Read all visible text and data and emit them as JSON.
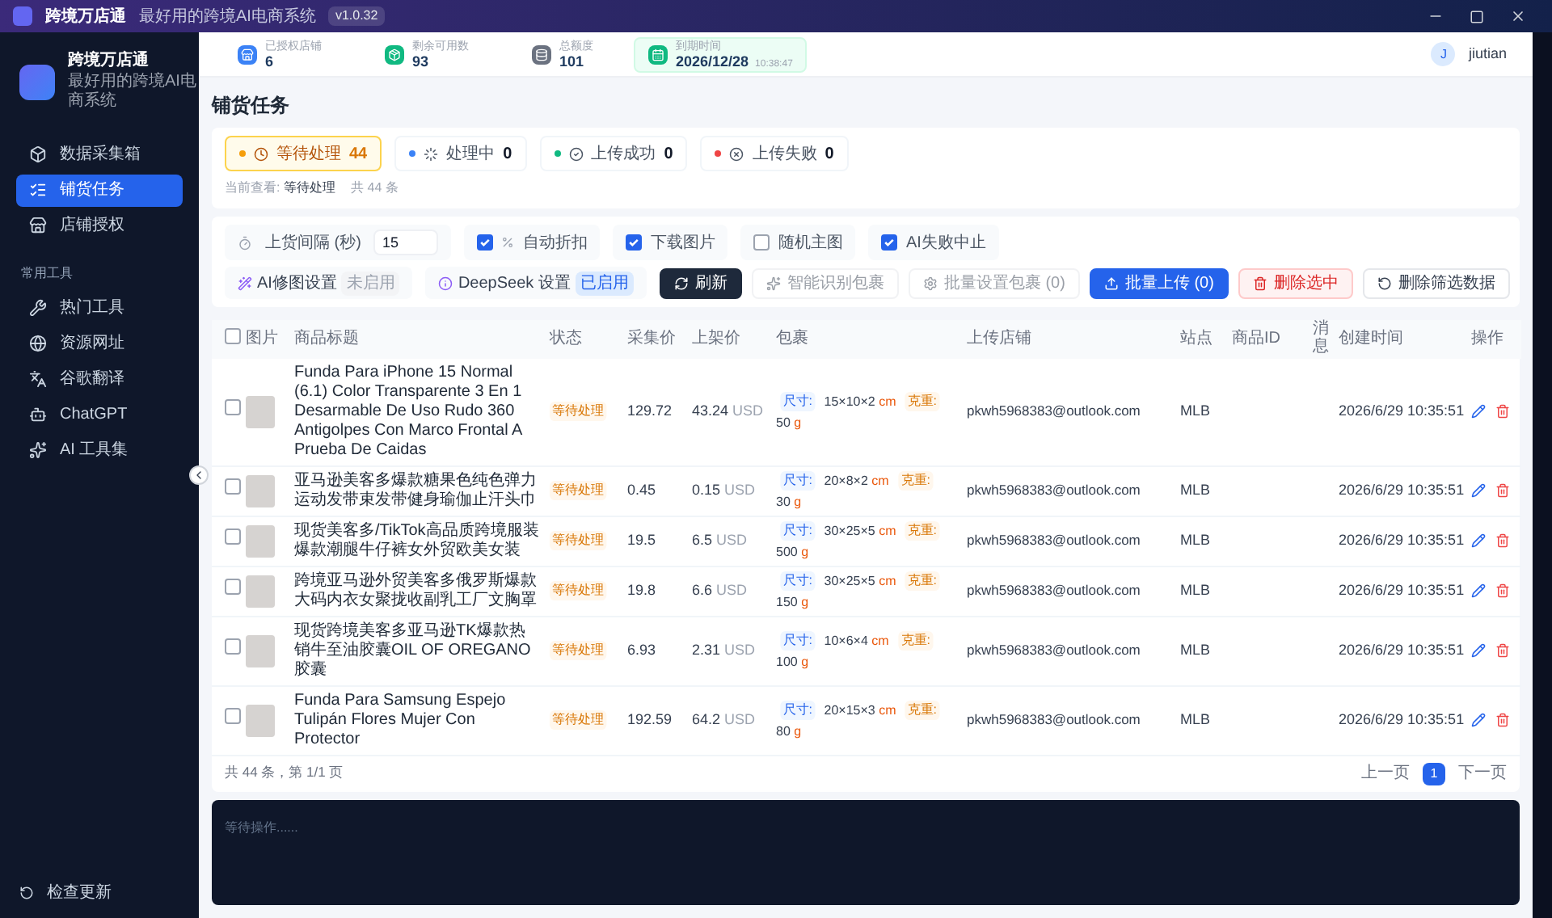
{
  "window": {
    "title": "跨境万店通",
    "subtitle": "最好用的跨境AI电商系统",
    "version": "v1.0.32"
  },
  "sidebar": {
    "brand": "跨境万店通",
    "tagline": "最好用的跨境AI电商系统",
    "items": [
      {
        "label": "数据采集箱",
        "selected": false
      },
      {
        "label": "铺货任务",
        "selected": true
      },
      {
        "label": "店铺授权",
        "selected": false
      }
    ],
    "section": "常用工具",
    "tools": [
      {
        "label": "热门工具"
      },
      {
        "label": "资源网址"
      },
      {
        "label": "谷歌翻译"
      },
      {
        "label": "ChatGPT"
      },
      {
        "label": "AI 工具集"
      }
    ],
    "footer": "检查更新"
  },
  "header": {
    "stats": [
      {
        "label": "已授权店铺",
        "value": "6",
        "color": "#3b82f6"
      },
      {
        "label": "剩余可用数",
        "value": "93",
        "color": "#10b981"
      },
      {
        "label": "总额度",
        "value": "101",
        "color": "#6b7280"
      },
      {
        "label": "到期时间",
        "value": "2026/12/28",
        "extra": "10:38:47",
        "color": "#10b981"
      }
    ],
    "user": {
      "initial": "J",
      "name": "jiutian"
    }
  },
  "page_title": "铺货任务",
  "status_tabs": [
    {
      "label": "等待处理",
      "count": "44",
      "color": "#f59e0b",
      "selected": true
    },
    {
      "label": "处理中",
      "count": "0",
      "color": "#3b82f6",
      "selected": false
    },
    {
      "label": "上传成功",
      "count": "0",
      "color": "#10b981",
      "selected": false
    },
    {
      "label": "上传失败",
      "count": "0",
      "color": "#ef4444",
      "selected": false
    }
  ],
  "viewing": {
    "label": "当前查看:",
    "value": "等待处理",
    "total": "共 44 条"
  },
  "settings": {
    "interval_label": "上货间隔 (秒)",
    "interval": "15",
    "options": [
      {
        "label": "自动折扣",
        "checked": true
      },
      {
        "label": "下载图片",
        "checked": true
      },
      {
        "label": "随机主图",
        "checked": false
      },
      {
        "label": "AI失败中止",
        "checked": true
      }
    ],
    "ai": [
      {
        "label": "AI修图设置",
        "badge": "未启用",
        "on": false
      },
      {
        "label": "DeepSeek 设置",
        "badge": "已启用",
        "on": true
      }
    ]
  },
  "actions": [
    {
      "label": "刷新",
      "kind": "dark",
      "disabled": false
    },
    {
      "label": "智能识别包裹",
      "kind": "plain",
      "disabled": true
    },
    {
      "label": "批量设置包裹 (0)",
      "kind": "plain",
      "disabled": true
    },
    {
      "label": "批量上传 (0)",
      "kind": "primary",
      "disabled": false
    },
    {
      "label": "删除选中",
      "kind": "danger",
      "disabled": false
    },
    {
      "label": "删除筛选数据",
      "kind": "plain",
      "disabled": false
    }
  ],
  "table": {
    "header_checked": false,
    "columns": [
      "图片",
      "商品标题",
      "状态",
      "采集价",
      "上架价",
      "包裹",
      "上传店铺",
      "站点",
      "商品ID",
      "消息",
      "创建时间",
      "操作"
    ],
    "rows": [
      {
        "title": "Funda Para iPhone 15 Normal (6.1) Color Transparente 3 En 1 Desarmable De Uso Rudo 360 Antigolpes Con Marco Frontal A Prueba De Caidas",
        "status": "等待处理",
        "cost": "129.72",
        "price": "43.24",
        "currency": "USD",
        "size_label": "尺寸:",
        "size": "15×10×2",
        "size_unit": "cm",
        "weight_label": "克重:",
        "weight": "50",
        "weight_unit": "g",
        "store": "pkwh5968383@outlook.com",
        "site": "MLB",
        "created": "2026/6/29 10:35:51",
        "checked": false
      },
      {
        "title": "亚马逊美客多爆款糖果色纯色弹力运动发带束发带健身瑜伽止汗头巾",
        "status": "等待处理",
        "cost": "0.45",
        "price": "0.15",
        "currency": "USD",
        "size_label": "尺寸:",
        "size": "20×8×2",
        "size_unit": "cm",
        "weight_label": "克重:",
        "weight": "30",
        "weight_unit": "g",
        "store": "pkwh5968383@outlook.com",
        "site": "MLB",
        "created": "2026/6/29 10:35:51",
        "checked": false
      },
      {
        "title": "现货美客多/TikTok高品质跨境服装爆款潮腿牛仔裤女外贸欧美女装",
        "status": "等待处理",
        "cost": "19.5",
        "price": "6.5",
        "currency": "USD",
        "size_label": "尺寸:",
        "size": "30×25×5",
        "size_unit": "cm",
        "weight_label": "克重:",
        "weight": "500",
        "weight_unit": "g",
        "store": "pkwh5968383@outlook.com",
        "site": "MLB",
        "created": "2026/6/29 10:35:51",
        "checked": false
      },
      {
        "title": "跨境亚马逊外贸美客多俄罗斯爆款大码内衣女聚拢收副乳工厂文胸罩",
        "status": "等待处理",
        "cost": "19.8",
        "price": "6.6",
        "currency": "USD",
        "size_label": "尺寸:",
        "size": "30×25×5",
        "size_unit": "cm",
        "weight_label": "克重:",
        "weight": "150",
        "weight_unit": "g",
        "store": "pkwh5968383@outlook.com",
        "site": "MLB",
        "created": "2026/6/29 10:35:51",
        "checked": false
      },
      {
        "title": "现货跨境美客多亚马逊TK爆款热销牛至油胶囊OIL OF OREGANO 胶囊",
        "status": "等待处理",
        "cost": "6.93",
        "price": "2.31",
        "currency": "USD",
        "size_label": "尺寸:",
        "size": "10×6×4",
        "size_unit": "cm",
        "weight_label": "克重:",
        "weight": "100",
        "weight_unit": "g",
        "store": "pkwh5968383@outlook.com",
        "site": "MLB",
        "created": "2026/6/29 10:35:51",
        "checked": false
      },
      {
        "title": "Funda Para Samsung Espejo Tulipán Flores Mujer Con Protector",
        "status": "等待处理",
        "cost": "192.59",
        "price": "64.2",
        "currency": "USD",
        "size_label": "尺寸:",
        "size": "20×15×3",
        "size_unit": "cm",
        "weight_label": "克重:",
        "weight": "80",
        "weight_unit": "g",
        "store": "pkwh5968383@outlook.com",
        "site": "MLB",
        "created": "2026/6/29 10:35:51",
        "checked": false
      }
    ]
  },
  "pagination": {
    "summary": "共 44 条，第 1/1 页",
    "prev": "上一页",
    "pages": [
      {
        "label": "1",
        "selected": true
      }
    ],
    "next": "下一页"
  },
  "log": {
    "text": "等待操作......"
  }
}
